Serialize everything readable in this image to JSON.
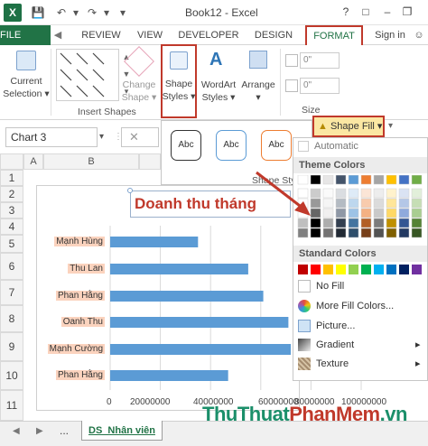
{
  "titlebar": {
    "title": "Book12 - Excel",
    "signin": "Sign in"
  },
  "tabs": {
    "file": "FILE",
    "review": "REVIEW",
    "view": "VIEW",
    "developer": "DEVELOPER",
    "design": "DESIGN",
    "format": "FORMAT"
  },
  "ribbon": {
    "current_selection": [
      "Current",
      "Selection ▾"
    ],
    "insert_shapes": "Insert Shapes",
    "change_shape": [
      "Change",
      "Shape ▾"
    ],
    "shape_styles": [
      "Shape",
      "Styles ▾"
    ],
    "wordart_styles": [
      "WordArt",
      "Styles ▾"
    ],
    "arrange": [
      "Arrange",
      "▾"
    ],
    "size_fields": [
      "0\"",
      "0\""
    ],
    "size_label": "Size",
    "shape_styles_label": "Shape Styl"
  },
  "namebox": "Chart 3",
  "columns": [
    "A",
    "B"
  ],
  "rows": [
    "1",
    "2",
    "3",
    "4",
    "5",
    "6",
    "7",
    "8",
    "9",
    "10",
    "11"
  ],
  "chart_data": {
    "type": "bar",
    "title": "Doanh thu tháng",
    "categories": [
      "Mạnh Hùng",
      "Thu Lan",
      "Phan Hằng",
      "Oanh Thu",
      "Mạnh Cường",
      "Phan Hằng"
    ],
    "values": [
      35000000,
      55000000,
      61000000,
      71000000,
      94000000,
      47000000
    ],
    "xticks": [
      "0",
      "20000000",
      "40000000",
      "60000000",
      "80000000",
      "100000000"
    ],
    "xlim": [
      0,
      100000000
    ],
    "grid": true,
    "bar_color": "#5b9bd5"
  },
  "gallery": {
    "abc": [
      "Abc",
      "Abc",
      "Abc"
    ]
  },
  "shape_fill": "Shape Fill ▾",
  "dropdown": {
    "automatic": "Automatic",
    "theme_colors": "Theme Colors",
    "standard_colors": "Standard Colors",
    "no_fill": "No Fill",
    "more_colors": "More Fill Colors...",
    "picture": "Picture...",
    "gradient": "Gradient",
    "texture": "Texture",
    "theme_palette": [
      "#ffffff",
      "#000000",
      "#e7e6e6",
      "#44546a",
      "#5b9bd5",
      "#ed7d31",
      "#a5a5a5",
      "#ffc000",
      "#4472c4",
      "#70ad47"
    ],
    "standard_palette": [
      "#c00000",
      "#ff0000",
      "#ffc000",
      "#ffff00",
      "#92d050",
      "#00b050",
      "#00b0f0",
      "#0070c0",
      "#002060",
      "#7030a0"
    ]
  },
  "sheet": {
    "tab": "DS_Nhân viên",
    "dots": "..."
  },
  "watermark": [
    "ThuThuat",
    "PhanMem",
    ".vn"
  ]
}
